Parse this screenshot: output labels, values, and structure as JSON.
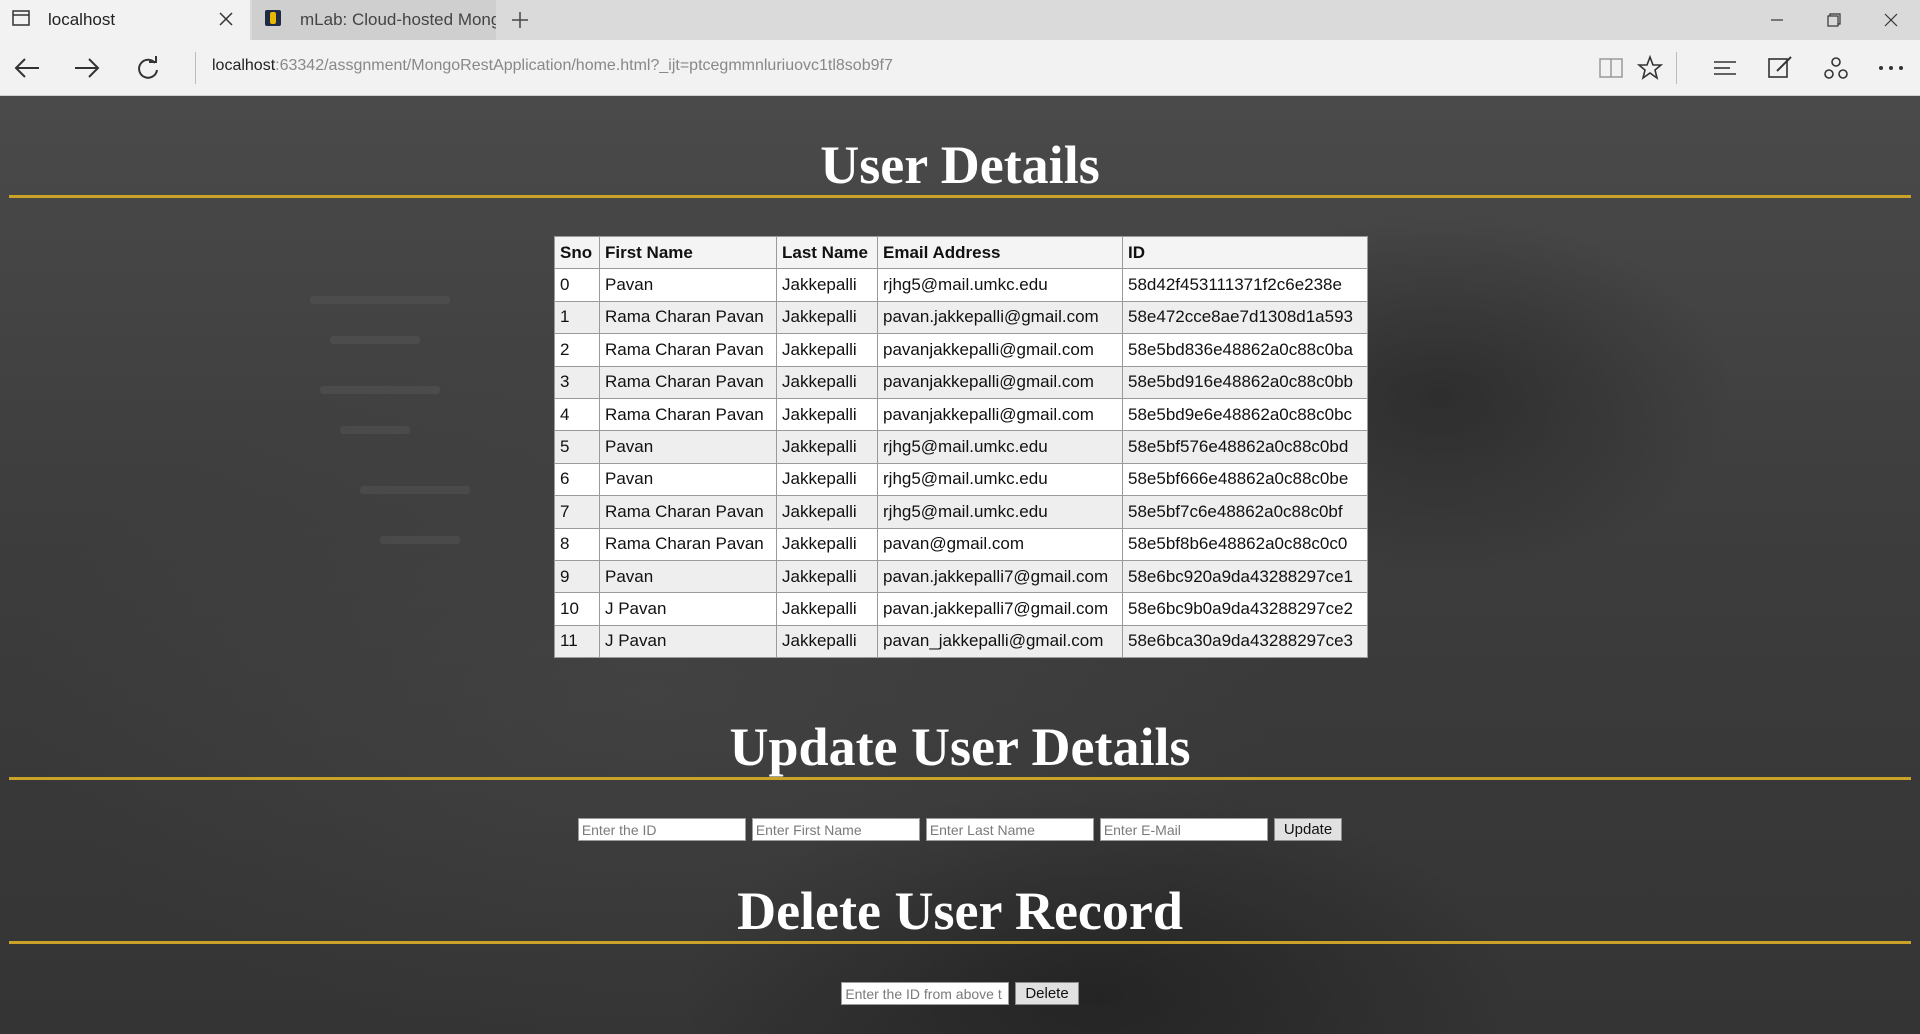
{
  "browser": {
    "tabs": [
      {
        "title": "localhost",
        "active": true
      },
      {
        "title": "mLab: Cloud-hosted Mongc",
        "active": false
      }
    ],
    "url_host": "localhost",
    "url_rest": ":63342/assgnment/MongoRestApplication/home.html?_ijt=ptcegmmnluriuovc1tl8sob9f7"
  },
  "page": {
    "user_details_title": "User Details",
    "update_title": "Update User Details",
    "delete_title": "Delete User Record",
    "accent_color": "#c9a227"
  },
  "table": {
    "headers": [
      "Sno",
      "First Name",
      "Last Name",
      "Email Address",
      "ID"
    ],
    "rows": [
      [
        "0",
        "Pavan",
        "Jakkepalli",
        "rjhg5@mail.umkc.edu",
        "58d42f453111371f2c6e238e"
      ],
      [
        "1",
        "Rama Charan Pavan",
        "Jakkepalli",
        "pavan.jakkepalli@gmail.com",
        "58e472cce8ae7d1308d1a593"
      ],
      [
        "2",
        "Rama Charan Pavan",
        "Jakkepalli",
        "pavanjakkepalli@gmail.com",
        "58e5bd836e48862a0c88c0ba"
      ],
      [
        "3",
        "Rama Charan Pavan",
        "Jakkepalli",
        "pavanjakkepalli@gmail.com",
        "58e5bd916e48862a0c88c0bb"
      ],
      [
        "4",
        "Rama Charan Pavan",
        "Jakkepalli",
        "pavanjakkepalli@gmail.com",
        "58e5bd9e6e48862a0c88c0bc"
      ],
      [
        "5",
        "Pavan",
        "Jakkepalli",
        "rjhg5@mail.umkc.edu",
        "58e5bf576e48862a0c88c0bd"
      ],
      [
        "6",
        "Pavan",
        "Jakkepalli",
        "rjhg5@mail.umkc.edu",
        "58e5bf666e48862a0c88c0be"
      ],
      [
        "7",
        "Rama Charan Pavan",
        "Jakkepalli",
        "rjhg5@mail.umkc.edu",
        "58e5bf7c6e48862a0c88c0bf"
      ],
      [
        "8",
        "Rama Charan Pavan",
        "Jakkepalli",
        "pavan@gmail.com",
        "58e5bf8b6e48862a0c88c0c0"
      ],
      [
        "9",
        "Pavan",
        "Jakkepalli",
        "pavan.jakkepalli7@gmail.com",
        "58e6bc920a9da43288297ce1"
      ],
      [
        "10",
        "J Pavan",
        "Jakkepalli",
        "pavan.jakkepalli7@gmail.com",
        "58e6bc9b0a9da43288297ce2"
      ],
      [
        "11",
        "J Pavan",
        "Jakkepalli",
        "pavan_jakkepalli@gmail.com",
        "58e6bca30a9da43288297ce3"
      ]
    ]
  },
  "update_form": {
    "id_placeholder": "Enter the ID",
    "first_placeholder": "Enter First Name",
    "last_placeholder": "Enter Last Name",
    "email_placeholder": "Enter E-Mail",
    "button_label": "Update"
  },
  "delete_form": {
    "id_placeholder": "Enter the ID from above t",
    "button_label": "Delete"
  }
}
